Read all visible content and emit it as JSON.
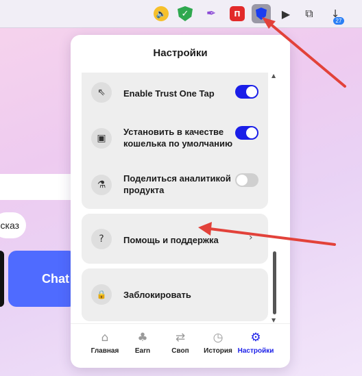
{
  "toolbar": {
    "extensions": [
      {
        "icon": "speaker-icon",
        "glyph": "🔈"
      },
      {
        "icon": "shield-check-icon",
        "glyph": "✓"
      },
      {
        "icon": "feather-icon",
        "glyph": "✒"
      },
      {
        "icon": "red-extension-icon",
        "glyph": "П"
      },
      {
        "icon": "trust-wallet-icon",
        "glyph": ""
      },
      {
        "icon": "play-circle-icon",
        "glyph": "▶"
      },
      {
        "icon": "extensions-icon",
        "glyph": "⧉"
      },
      {
        "icon": "download-icon",
        "glyph": "↓"
      }
    ],
    "download_badge": "27"
  },
  "background": {
    "chip_text": "сказ",
    "chat_card_text": "Chat"
  },
  "popup": {
    "title": "Настройки",
    "settings_items": [
      {
        "label": "Enable Trust One Tap",
        "icon": "pointer-click-icon",
        "glyph": "⇖",
        "toggle": "on"
      },
      {
        "label": "Установить в качестве кошелька по умолчанию",
        "icon": "wallet-icon",
        "glyph": "▣",
        "toggle": "on"
      },
      {
        "label": "Поделиться аналитикой продукта",
        "icon": "microscope-icon",
        "glyph": "⚗",
        "toggle": "off"
      }
    ],
    "help_item": {
      "label": "Помощь и поддержка",
      "icon": "question-icon",
      "glyph": "?"
    },
    "lock_item": {
      "label": "Заблокировать",
      "icon": "lock-icon",
      "glyph": "🔒"
    },
    "nav": [
      {
        "label": "Главная",
        "icon": "home-icon",
        "glyph": "⌂",
        "active": false
      },
      {
        "label": "Earn",
        "icon": "sprout-icon",
        "glyph": "♣",
        "active": false
      },
      {
        "label": "Своп",
        "icon": "swap-icon",
        "glyph": "⇄",
        "active": false
      },
      {
        "label": "История",
        "icon": "history-icon",
        "glyph": "◷",
        "active": false
      },
      {
        "label": "Настройки",
        "icon": "gear-icon",
        "glyph": "⚙",
        "active": true
      }
    ]
  },
  "colors": {
    "accent": "#1a1ee8",
    "annotation_arrow": "#e2423a"
  }
}
